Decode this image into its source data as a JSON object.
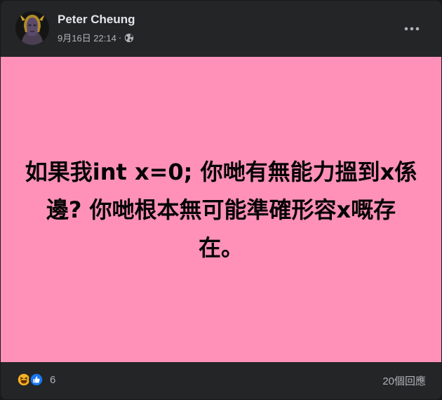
{
  "post": {
    "author": "Peter Cheung",
    "date": "9月16日 22:14",
    "separator": "·",
    "visibility_icon": "globe-icon",
    "menu_icon": "more-dots-icon",
    "text": "如果我int x=0; 你哋有無能力搵到x係邊? 你哋根本無可能準確形容x嘅存在。",
    "background_color": "#ff91b8"
  },
  "footer": {
    "reaction_icons": [
      "haha-reaction-icon",
      "like-reaction-icon"
    ],
    "reaction_count": "6",
    "comments_label": "20個回應"
  }
}
